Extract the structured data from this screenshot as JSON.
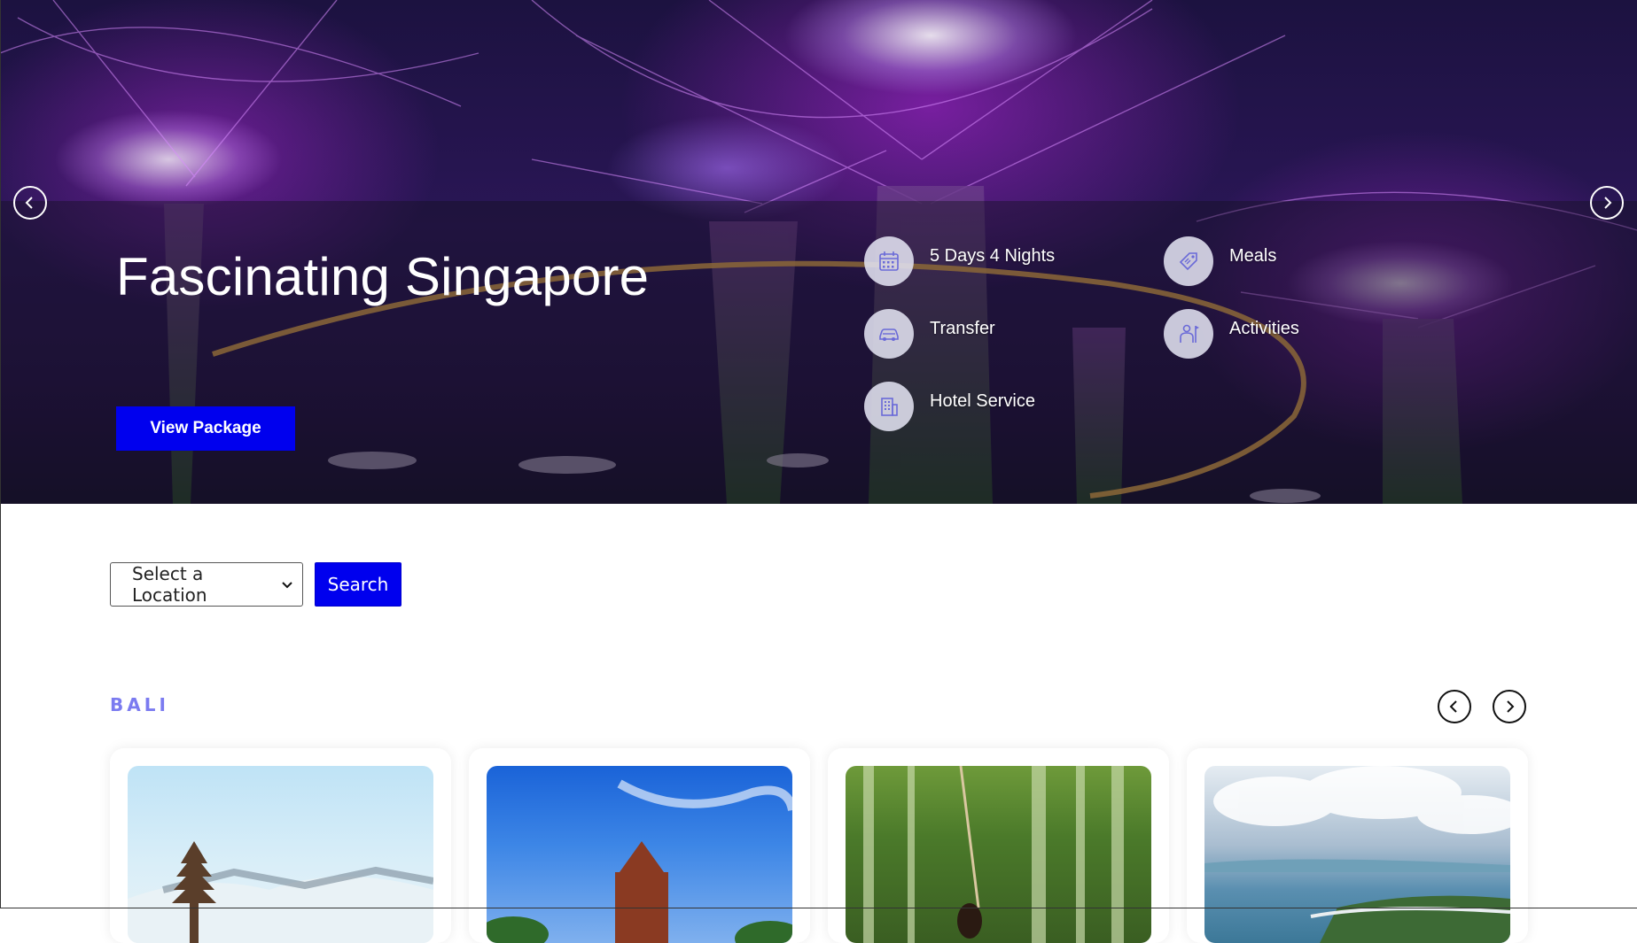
{
  "hero": {
    "title": "Fascinating Singapore",
    "cta_label": "View Package",
    "features": [
      {
        "label": "5 Days 4 Nights",
        "icon": "calendar-icon"
      },
      {
        "label": "Meals",
        "icon": "meal-tag-icon"
      },
      {
        "label": "Transfer",
        "icon": "car-icon"
      },
      {
        "label": "Activities",
        "icon": "guide-person-icon"
      },
      {
        "label": "Hotel Service",
        "icon": "building-icon"
      }
    ],
    "prev_icon": "chevron-left-icon",
    "next_icon": "chevron-right-icon"
  },
  "search": {
    "location_selected": "Select a Location",
    "button_label": "Search"
  },
  "section": {
    "title": "BALI",
    "accent_color": "#7b7bf0"
  },
  "colors": {
    "primary_button": "#0000ee"
  }
}
